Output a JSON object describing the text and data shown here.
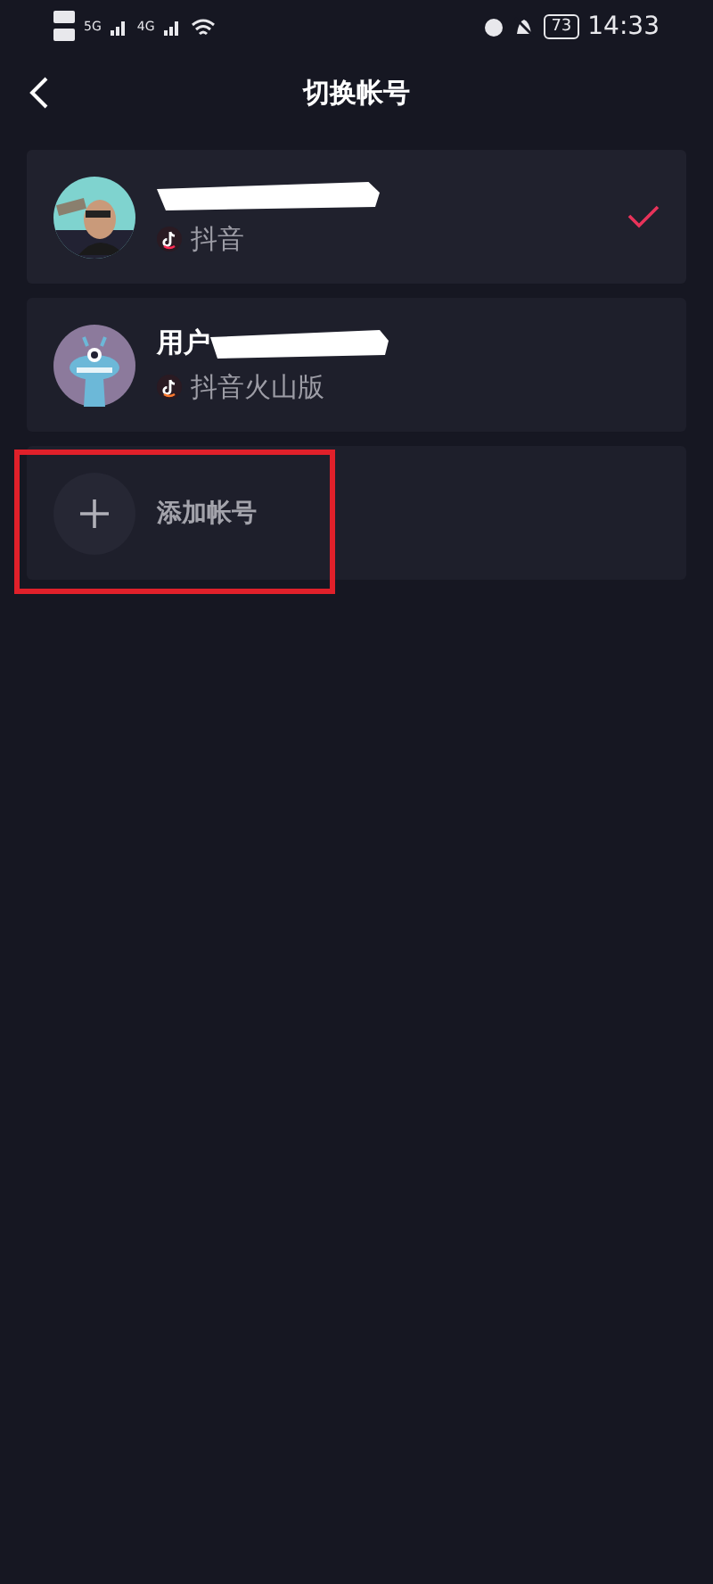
{
  "status_bar": {
    "network_1": "5G",
    "network_2": "4G",
    "battery": "73",
    "time": "14:33"
  },
  "header": {
    "title": "切换帐号"
  },
  "accounts": [
    {
      "kind": "douyin",
      "name_redacted": true,
      "app": "抖音",
      "selected": true
    },
    {
      "kind": "huoshan",
      "name": "用户",
      "name_redacted": true,
      "app": "抖音火山版",
      "selected": false
    }
  ],
  "add_account": {
    "label": "添加帐号",
    "highlighted": true
  }
}
